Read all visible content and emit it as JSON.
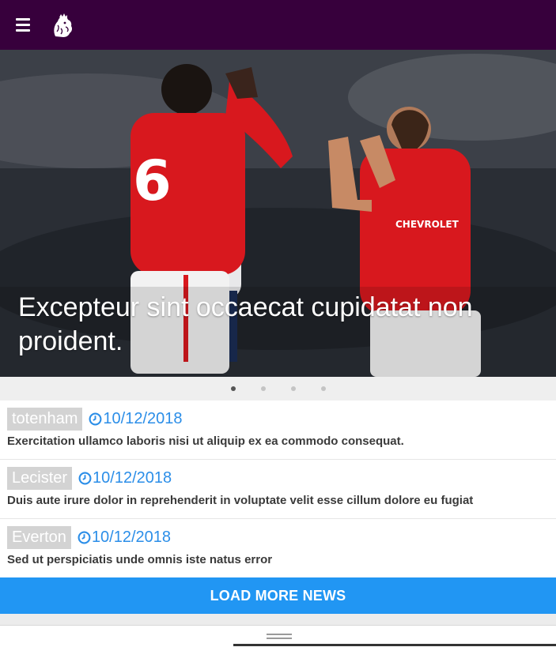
{
  "header": {
    "menu_icon": "hamburger-menu-icon",
    "logo_icon": "premier-league-lion-logo",
    "background_color": "#37003c"
  },
  "hero": {
    "caption": "Excepteur sint occaecat cupidatat non proident.",
    "slides_count": 4,
    "active_slide": 1
  },
  "news": [
    {
      "tag": "totenham",
      "date": "10/12/2018",
      "title": "Exercitation ullamco laboris nisi ut aliquip ex ea commodo consequat."
    },
    {
      "tag": "Lecister",
      "date": "10/12/2018",
      "title": "Duis aute irure dolor in reprehenderit in voluptate velit esse cillum dolore eu fugiat"
    },
    {
      "tag": "Everton",
      "date": "10/12/2018",
      "title": "Sed ut perspiciatis unde omnis iste natus error"
    }
  ],
  "load_more": {
    "label": "LOAD MORE NEWS",
    "color": "#2196f3"
  },
  "colors": {
    "accent": "#2b8ee8",
    "tag_bg": "#d3d3d3"
  }
}
